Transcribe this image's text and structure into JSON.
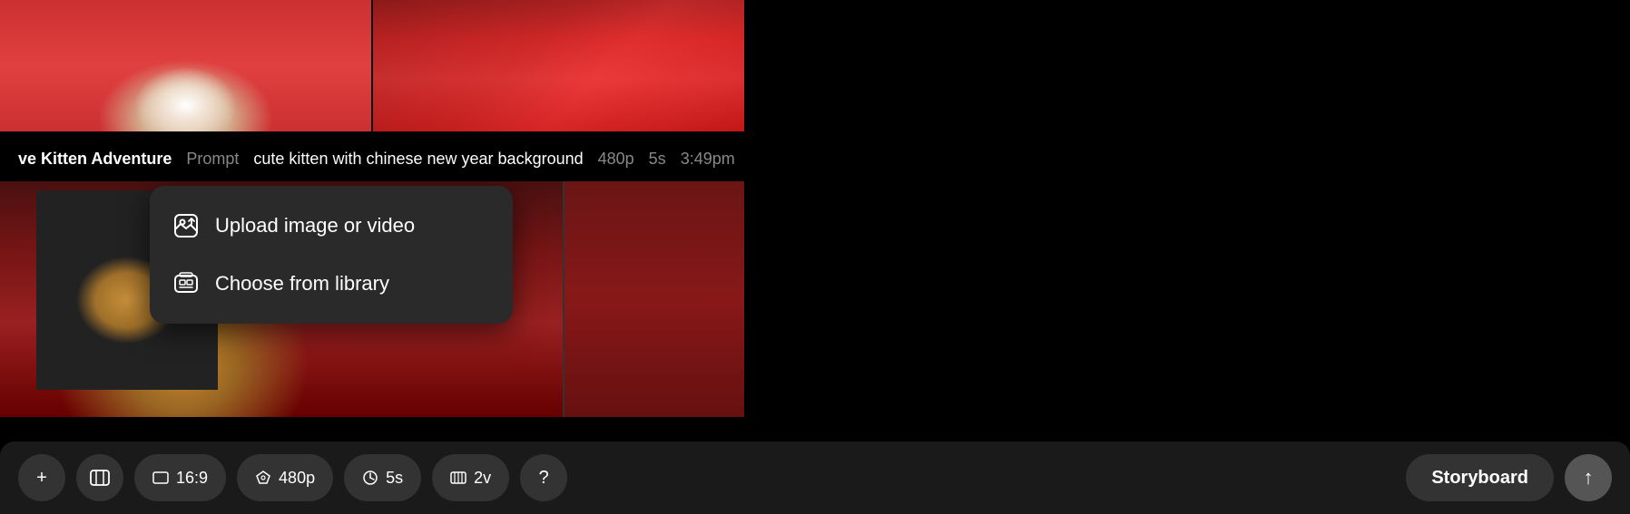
{
  "title": "ve Kitten Adventure",
  "infoBar": {
    "title": "ve Kitten Adventure",
    "promptLabel": "Prompt",
    "promptText": "cute kitten with chinese new year background",
    "resolution": "480p",
    "duration": "5s",
    "time": "3:49pm"
  },
  "dropdown": {
    "items": [
      {
        "id": "upload",
        "icon": "📷",
        "label": "Upload image or video"
      },
      {
        "id": "library",
        "icon": "🖼",
        "label": "Choose from library"
      }
    ]
  },
  "toolbar": {
    "addLabel": "+",
    "aspectRatio": "16:9",
    "resolution": "480p",
    "duration": "5s",
    "version": "2v",
    "helpLabel": "?",
    "storyboardLabel": "Storyboard",
    "submitArrow": "↑"
  }
}
